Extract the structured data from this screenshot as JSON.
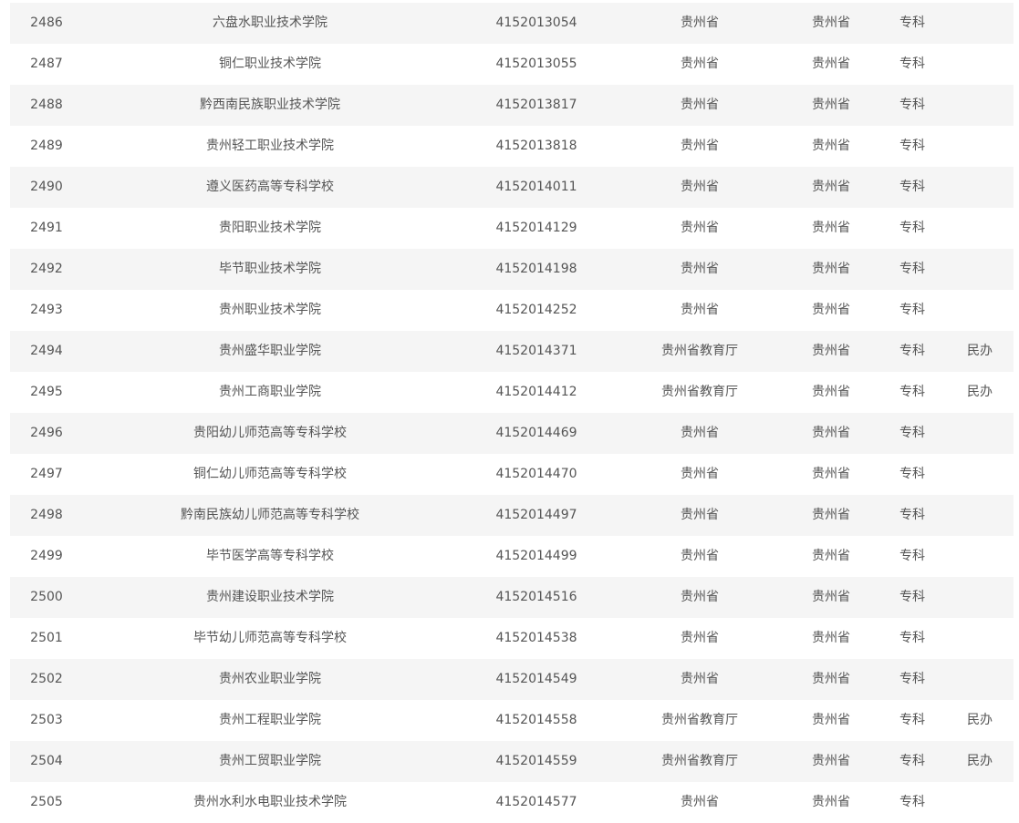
{
  "rows": [
    {
      "idx": "2486",
      "name": "六盘水职业技术学院",
      "code": "4152013054",
      "dept": "贵州省",
      "loc": "贵州省",
      "level": "专科",
      "note": ""
    },
    {
      "idx": "2487",
      "name": "铜仁职业技术学院",
      "code": "4152013055",
      "dept": "贵州省",
      "loc": "贵州省",
      "level": "专科",
      "note": ""
    },
    {
      "idx": "2488",
      "name": "黔西南民族职业技术学院",
      "code": "4152013817",
      "dept": "贵州省",
      "loc": "贵州省",
      "level": "专科",
      "note": ""
    },
    {
      "idx": "2489",
      "name": "贵州轻工职业技术学院",
      "code": "4152013818",
      "dept": "贵州省",
      "loc": "贵州省",
      "level": "专科",
      "note": ""
    },
    {
      "idx": "2490",
      "name": "遵义医药高等专科学校",
      "code": "4152014011",
      "dept": "贵州省",
      "loc": "贵州省",
      "level": "专科",
      "note": ""
    },
    {
      "idx": "2491",
      "name": "贵阳职业技术学院",
      "code": "4152014129",
      "dept": "贵州省",
      "loc": "贵州省",
      "level": "专科",
      "note": ""
    },
    {
      "idx": "2492",
      "name": "毕节职业技术学院",
      "code": "4152014198",
      "dept": "贵州省",
      "loc": "贵州省",
      "level": "专科",
      "note": ""
    },
    {
      "idx": "2493",
      "name": "贵州职业技术学院",
      "code": "4152014252",
      "dept": "贵州省",
      "loc": "贵州省",
      "level": "专科",
      "note": ""
    },
    {
      "idx": "2494",
      "name": "贵州盛华职业学院",
      "code": "4152014371",
      "dept": "贵州省教育厅",
      "loc": "贵州省",
      "level": "专科",
      "note": "民办"
    },
    {
      "idx": "2495",
      "name": "贵州工商职业学院",
      "code": "4152014412",
      "dept": "贵州省教育厅",
      "loc": "贵州省",
      "level": "专科",
      "note": "民办"
    },
    {
      "idx": "2496",
      "name": "贵阳幼儿师范高等专科学校",
      "code": "4152014469",
      "dept": "贵州省",
      "loc": "贵州省",
      "level": "专科",
      "note": ""
    },
    {
      "idx": "2497",
      "name": "铜仁幼儿师范高等专科学校",
      "code": "4152014470",
      "dept": "贵州省",
      "loc": "贵州省",
      "level": "专科",
      "note": ""
    },
    {
      "idx": "2498",
      "name": "黔南民族幼儿师范高等专科学校",
      "code": "4152014497",
      "dept": "贵州省",
      "loc": "贵州省",
      "level": "专科",
      "note": ""
    },
    {
      "idx": "2499",
      "name": "毕节医学高等专科学校",
      "code": "4152014499",
      "dept": "贵州省",
      "loc": "贵州省",
      "level": "专科",
      "note": ""
    },
    {
      "idx": "2500",
      "name": "贵州建设职业技术学院",
      "code": "4152014516",
      "dept": "贵州省",
      "loc": "贵州省",
      "level": "专科",
      "note": ""
    },
    {
      "idx": "2501",
      "name": "毕节幼儿师范高等专科学校",
      "code": "4152014538",
      "dept": "贵州省",
      "loc": "贵州省",
      "level": "专科",
      "note": ""
    },
    {
      "idx": "2502",
      "name": "贵州农业职业学院",
      "code": "4152014549",
      "dept": "贵州省",
      "loc": "贵州省",
      "level": "专科",
      "note": ""
    },
    {
      "idx": "2503",
      "name": "贵州工程职业学院",
      "code": "4152014558",
      "dept": "贵州省教育厅",
      "loc": "贵州省",
      "level": "专科",
      "note": "民办"
    },
    {
      "idx": "2504",
      "name": "贵州工贸职业学院",
      "code": "4152014559",
      "dept": "贵州省教育厅",
      "loc": "贵州省",
      "level": "专科",
      "note": "民办"
    },
    {
      "idx": "2505",
      "name": "贵州水利水电职业技术学院",
      "code": "4152014577",
      "dept": "贵州省",
      "loc": "贵州省",
      "level": "专科",
      "note": ""
    }
  ]
}
